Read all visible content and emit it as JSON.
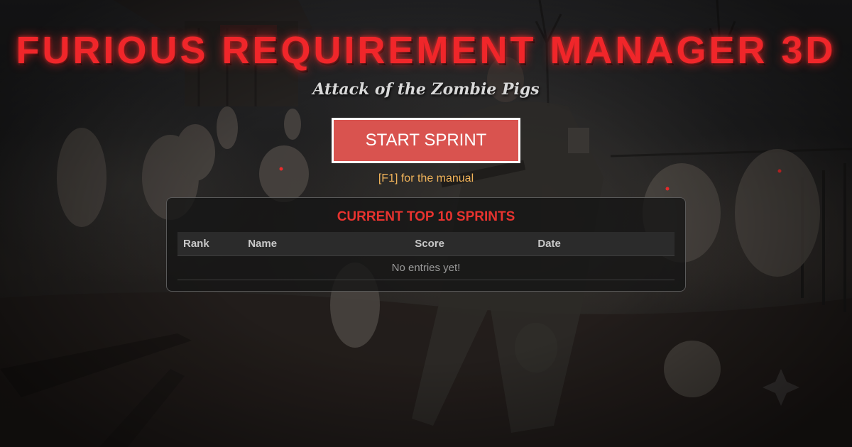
{
  "game": {
    "title": "FURIOUS REQUIREMENT MANAGER 3D",
    "subtitle": "Attack of the Zombie Pigs"
  },
  "menu": {
    "start_label": "START SPRINT",
    "manual_hint": "[F1] for the manual"
  },
  "leaderboard": {
    "title": "CURRENT TOP 10 SPRINTS",
    "columns": [
      "Rank",
      "Name",
      "Score",
      "Date"
    ],
    "rows": [],
    "empty_message": "No entries yet!"
  },
  "colors": {
    "title": "#f0262a",
    "start_button_bg": "#d9534f",
    "manual_hint": "#f0b35a",
    "leaderboard_title": "#e8332f"
  },
  "background": {
    "scene": "dark farm with zombie pigs and an armed soldier",
    "icons": [
      "barn",
      "dead-trees",
      "zombie-pig",
      "soldier",
      "fence",
      "sparkle-icon"
    ]
  }
}
